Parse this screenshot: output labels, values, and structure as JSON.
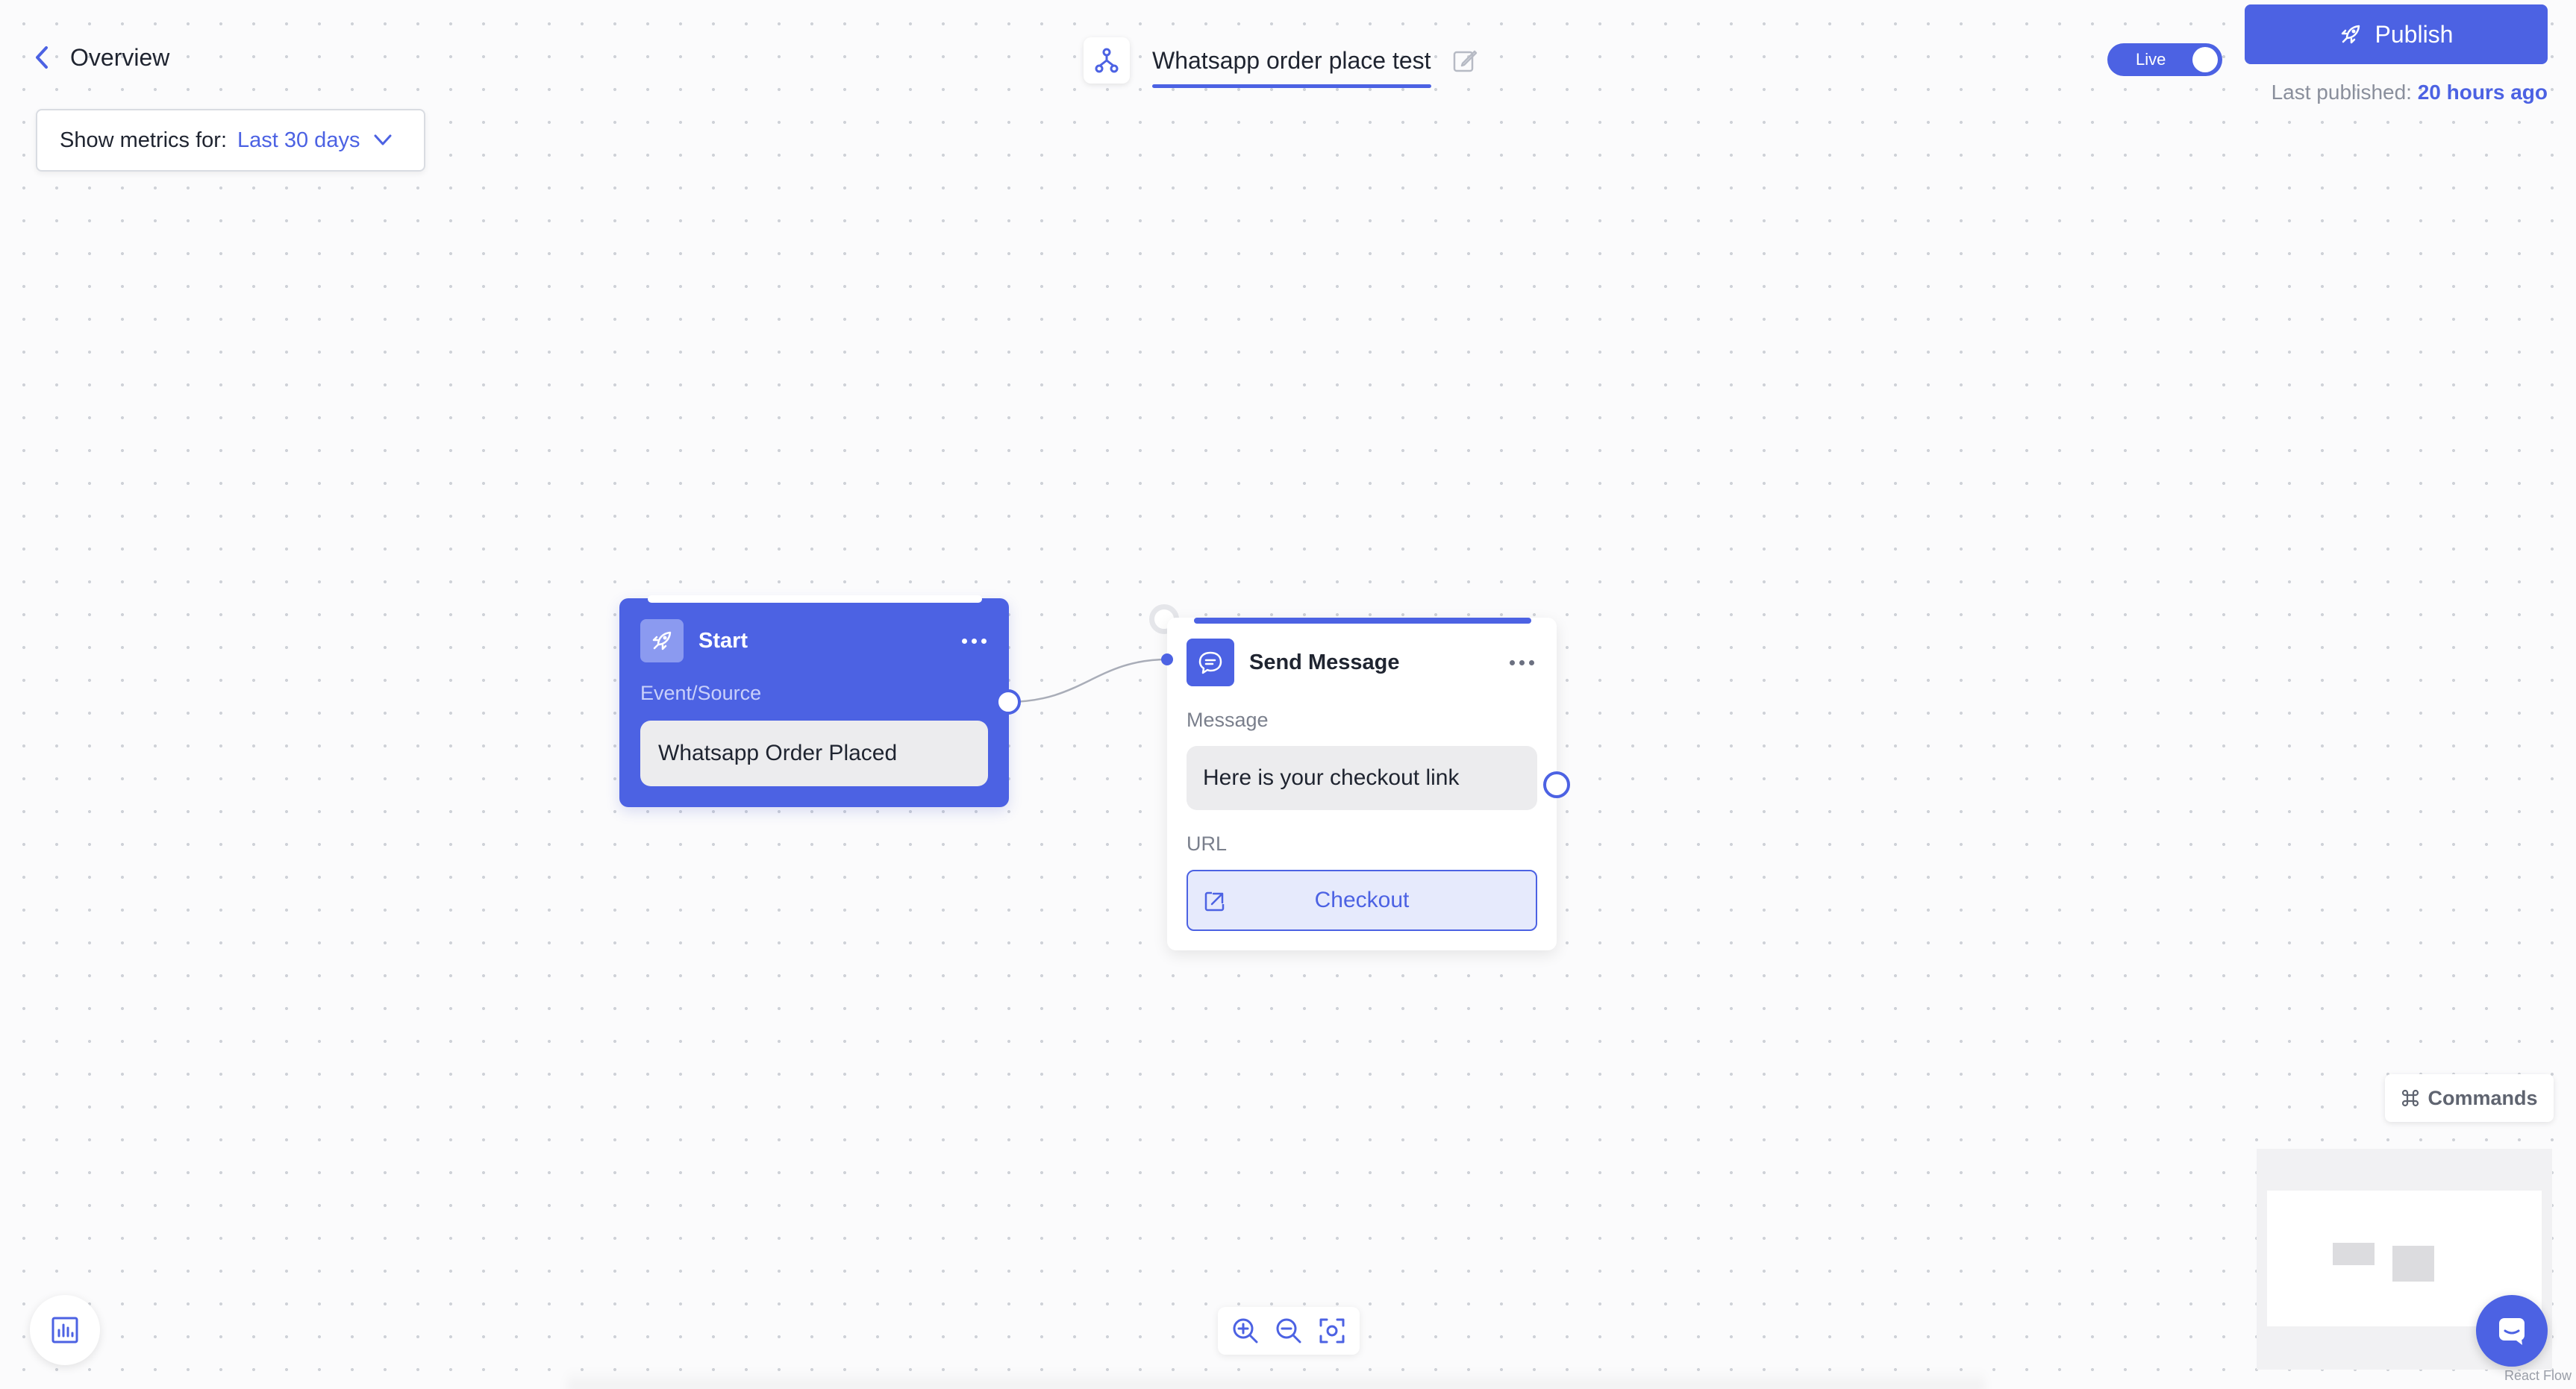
{
  "header": {
    "back_label": "Overview",
    "flow_title": "Whatsapp order place test",
    "live_label": "Live",
    "publish_label": "Publish",
    "last_published_prefix": "Last published:",
    "last_published_value": "20 hours ago"
  },
  "metrics": {
    "label": "Show metrics for:",
    "selected": "Last 30 days"
  },
  "nodes": {
    "start": {
      "title": "Start",
      "sublabel": "Event/Source",
      "event": "Whatsapp Order Placed"
    },
    "send_message": {
      "title": "Send Message",
      "message_label": "Message",
      "message_text": "Here is your checkout link",
      "url_label": "URL",
      "url_button": "Checkout"
    }
  },
  "toolbar": {
    "commands_label": "Commands"
  },
  "attribution": "React Flow",
  "colors": {
    "accent": "#4c62e3",
    "canvas": "#fbfbfc",
    "input_bg": "#ececee"
  },
  "icons": [
    "chevron-left-icon",
    "flow-icon",
    "edit-icon",
    "rocket-icon",
    "chevron-down-icon",
    "chat-bubble-icon",
    "external-link-icon",
    "command-icon",
    "chat-icon",
    "analytics-icon",
    "zoom-in-icon",
    "zoom-out-icon",
    "fit-view-icon"
  ]
}
